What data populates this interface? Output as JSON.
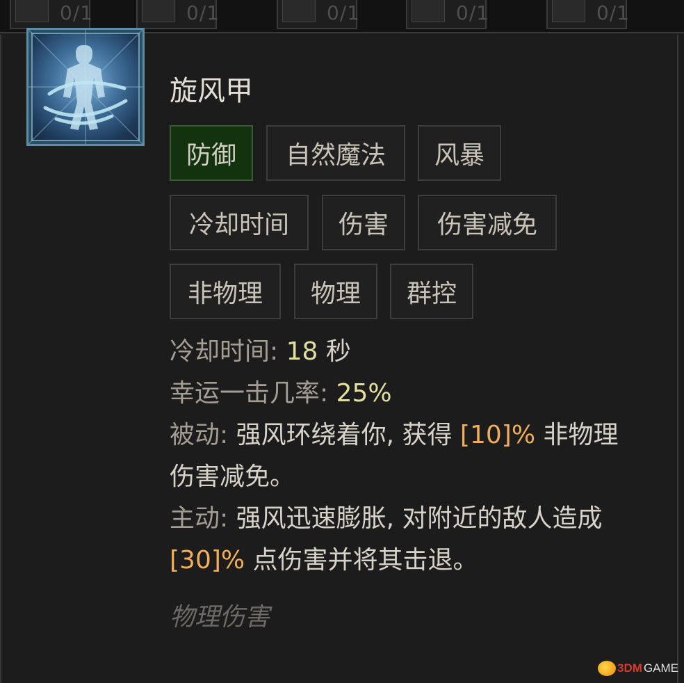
{
  "top_strip": {
    "slots": [
      {
        "count": "0/1"
      },
      {
        "count": "0/1"
      },
      {
        "count": "0/1"
      },
      {
        "count": "0/1"
      },
      {
        "count": "0/1"
      }
    ]
  },
  "skill": {
    "icon": "whirlwind-armor-icon",
    "title": "旋风甲",
    "tags": [
      "防御",
      "自然魔法",
      "风暴",
      "冷却时间",
      "伤害",
      "伤害减免",
      "非物理",
      "物理",
      "群控"
    ],
    "active_tag": "防御",
    "cooldown": {
      "label": "冷却时间: ",
      "value": "18",
      "unit": " 秒"
    },
    "lucky_hit": {
      "label": "幸运一击几率: ",
      "value": "25%"
    },
    "passive": {
      "label": "被动: ",
      "text_before": "强风环绕着你, 获得 ",
      "value": "[10]%",
      "text_after": " 非物理",
      "text_line2": "伤害减免。"
    },
    "active": {
      "label": "主动: ",
      "text_line1": "强风迅速膨胀, 对附近的敌人造成",
      "value": "[30]%",
      "text_after": " 点伤害并将其击退。"
    },
    "damage_type": "物理伤害"
  },
  "watermark": {
    "prefix": "3DM",
    "suffix": "GAME"
  },
  "colors": {
    "background": "#1b1b1b",
    "active_tag_bg": "#13330f",
    "value_yellow": "#e3dfa0",
    "value_orange": "#f0ad5a",
    "label_gray": "#a39d93"
  }
}
